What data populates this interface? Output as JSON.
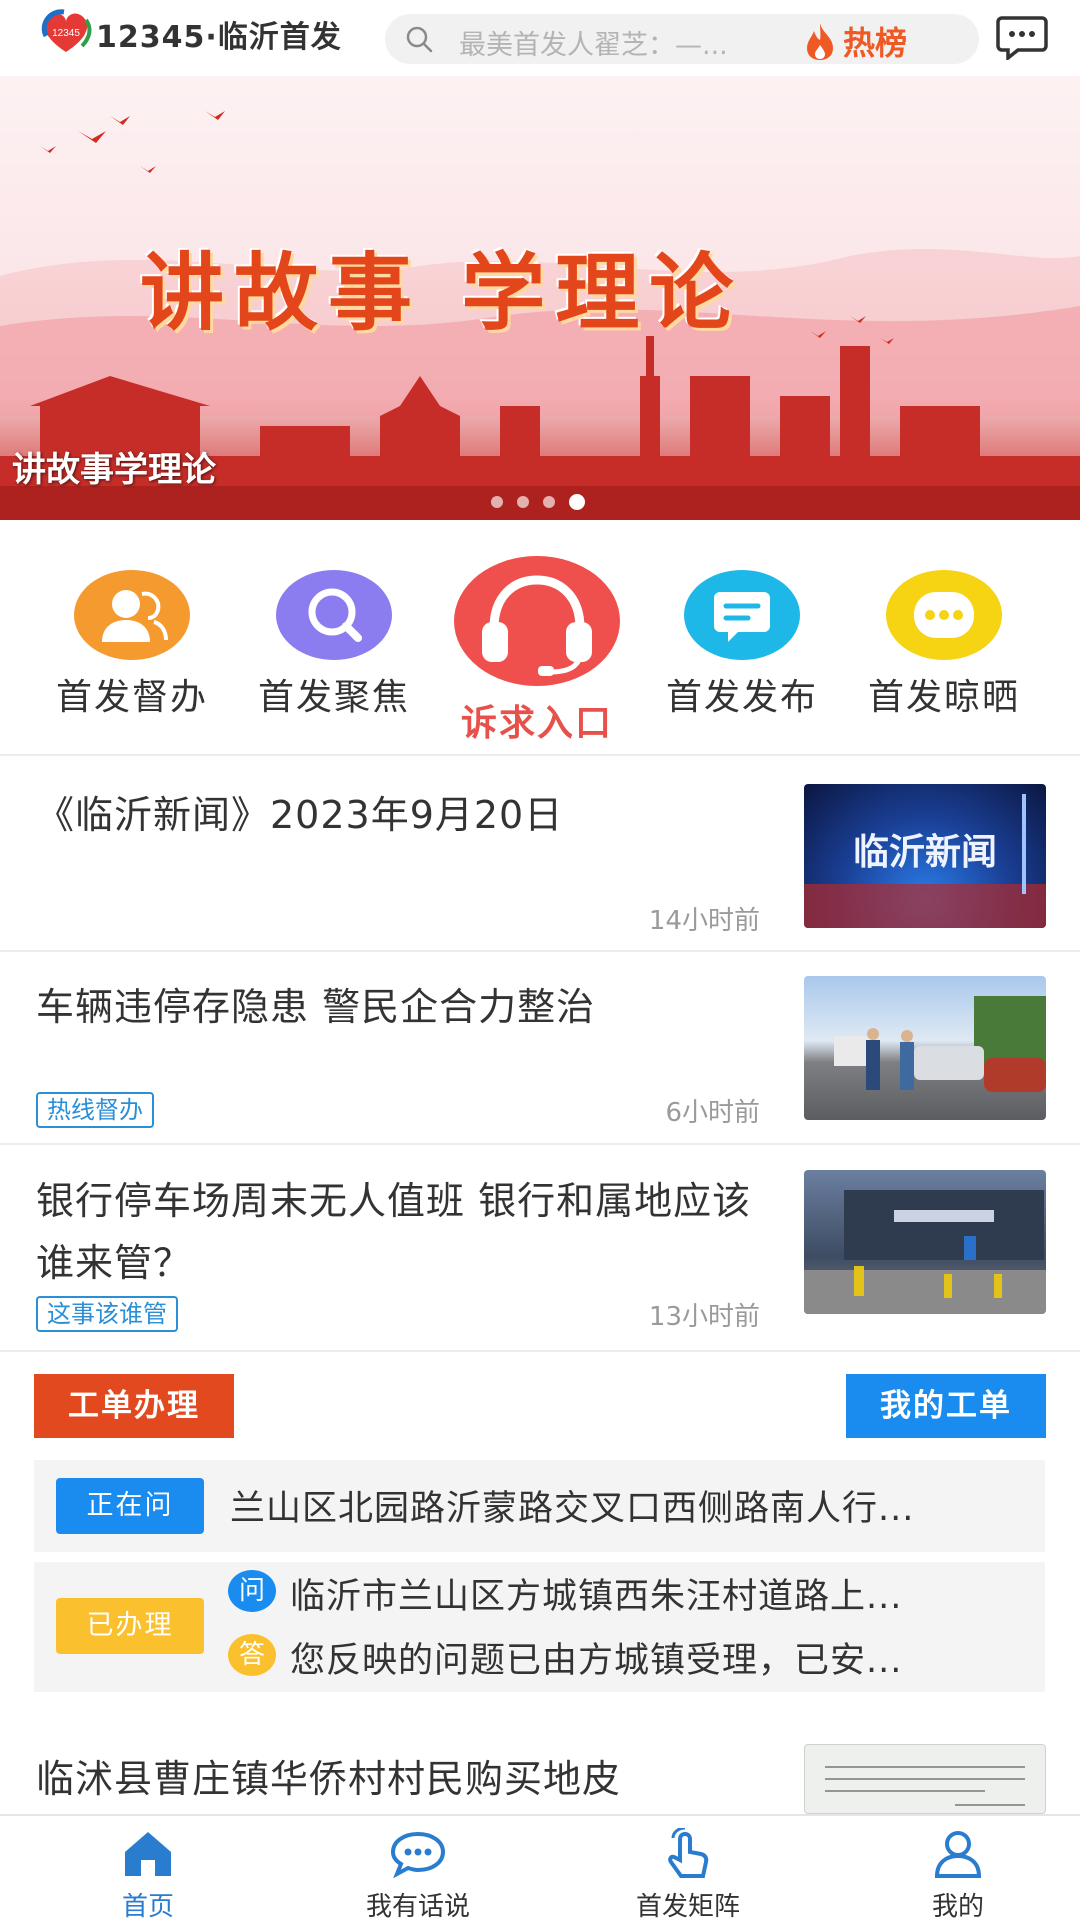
{
  "header": {
    "logo_badge": "12345",
    "app_title": "12345·临沂首发",
    "search_placeholder": "最美首发人翟芝：—...",
    "hot_label": "热榜"
  },
  "banner": {
    "headline": "讲故事 学理论",
    "caption": "讲故事学理论",
    "slide_count": 4,
    "active_slide": 4
  },
  "quick_entries": [
    {
      "label": "首发督办",
      "icon": "people-icon",
      "color": "#f59a2e"
    },
    {
      "label": "首发聚焦",
      "icon": "magnifier-icon",
      "color": "#8b7cf0"
    },
    {
      "label": "诉求入口",
      "icon": "headset-icon",
      "color": "#f0504d"
    },
    {
      "label": "首发发布",
      "icon": "chat-bubble-icon",
      "color": "#1eb8e8"
    },
    {
      "label": "首发晾晒",
      "icon": "ellipsis-icon",
      "color": "#f6d313"
    }
  ],
  "news": [
    {
      "title": "《临沂新闻》2023年9月20日",
      "time": "14小时前",
      "tag": "",
      "thumb": "临沂新闻"
    },
    {
      "title": "车辆违停存隐患  警民企合力整治",
      "time": "6小时前",
      "tag": "热线督办",
      "thumb": ""
    },
    {
      "title": "银行停车场周末无人值班  银行和属地应该谁来管？",
      "time": "13小时前",
      "tag": "这事该谁管",
      "thumb": ""
    }
  ],
  "work_order": {
    "handle_label": "工单办理",
    "mine_label": "我的工单",
    "asking": {
      "status": "正在问",
      "text": "兰山区北园路沂蒙路交叉口西侧路南人行..."
    },
    "done": {
      "status": "已办理",
      "question_badge": "问",
      "question": "临沂市兰山区方城镇西朱汪村道路上...",
      "answer_badge": "答",
      "answer": "您反映的问题已由方城镇受理，已安..."
    }
  },
  "partial_news": {
    "title": "临沭县曹庄镇华侨村村民购买地皮"
  },
  "tabbar": [
    {
      "label": "首页",
      "icon": "home-icon",
      "active": true
    },
    {
      "label": "我有话说",
      "icon": "speech-icon",
      "active": false
    },
    {
      "label": "首发矩阵",
      "icon": "tap-icon",
      "active": false
    },
    {
      "label": "我的",
      "icon": "user-icon",
      "active": false
    }
  ],
  "colors": {
    "accent_blue": "#1a8cf0",
    "accent_red": "#e2491f",
    "status_yellow": "#fbc02d",
    "tag_blue": "#2a8fd7"
  }
}
